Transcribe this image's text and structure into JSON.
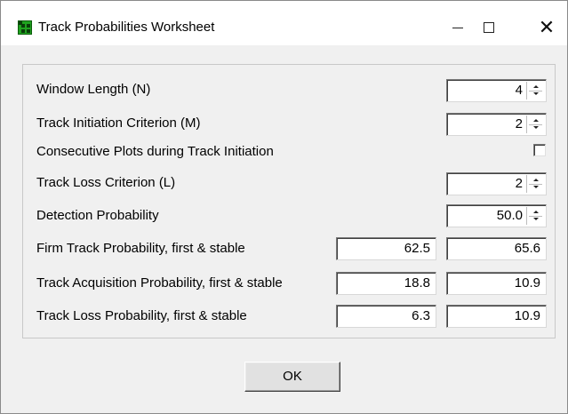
{
  "window": {
    "title": "Track Probabilities Worksheet",
    "controls": {
      "minimize": "—",
      "maximize": "☐",
      "close": "✕"
    }
  },
  "params": [
    {
      "label": "Window Length (N)",
      "value": "4"
    },
    {
      "label": "Track Initiation Criterion (M)",
      "value": "2"
    },
    {
      "label": "Consecutive Plots during Track Initiation",
      "checked": false
    },
    {
      "label": "Track Loss Criterion (L)",
      "value": "2"
    },
    {
      "label": "Detection Probability",
      "value": "50.0"
    }
  ],
  "results": [
    {
      "label": "Firm Track Probability, first & stable",
      "first": "62.5",
      "stable": "65.6"
    },
    {
      "label": "Track Acquisition Probability, first & stable",
      "first": "18.8",
      "stable": "10.9"
    },
    {
      "label": "Track Loss Probability, first & stable",
      "first": "6.3",
      "stable": "10.9"
    }
  ],
  "buttons": {
    "ok": "OK"
  }
}
